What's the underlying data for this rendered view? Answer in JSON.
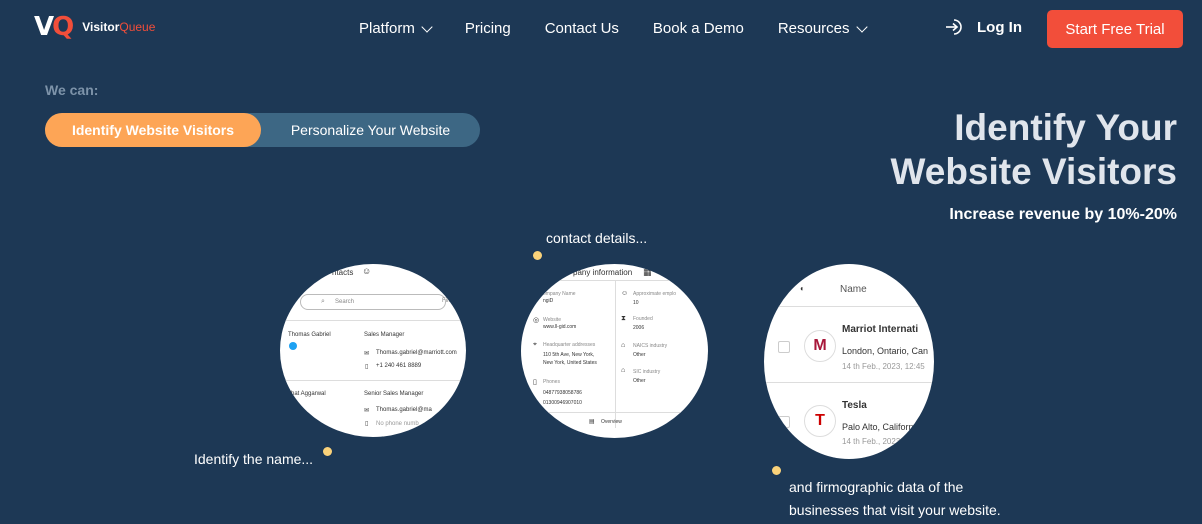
{
  "brand": {
    "mark_v": "V",
    "mark_q": "Q",
    "name_main": "Visitor",
    "name_q": "Queue",
    "accent": "#f24e3a"
  },
  "nav": {
    "items": [
      {
        "label": "Platform",
        "dropdown": true
      },
      {
        "label": "Pricing",
        "dropdown": false
      },
      {
        "label": "Contact Us",
        "dropdown": false
      },
      {
        "label": "Book a Demo",
        "dropdown": false
      },
      {
        "label": "Resources",
        "dropdown": true
      }
    ],
    "login": "Log In",
    "cta": "Start Free Trial"
  },
  "hero": {
    "we_can": "We can:",
    "toggle": {
      "active": "Identify Website Visitors",
      "inactive": "Personalize Your Website"
    },
    "headline_line1": "Identify Your",
    "headline_line2": "Website Visitors",
    "subhead": "Increase revenue by 10%-20%"
  },
  "captions": {
    "name": "Identify the name...",
    "contact": "contact details...",
    "firmo_line1": "and firmographic data of the",
    "firmo_line2": "businesses that visit your website."
  },
  "circle1": {
    "tab": "ntacts",
    "search": "Search",
    "filter": "Filt",
    "p1_name": "Thomas Gabriel",
    "p1_title": "Sales Manager",
    "p1_email": "Thomas.gabriel@marriott.com",
    "p1_phone": "+1 240 461 8889",
    "p2_name": "shat Aggarwal",
    "p2_title": "Senior Sales Manager",
    "p2_email": "Thomas.gabriel@ma",
    "p2_phone": "No phone numb"
  },
  "circle2": {
    "tab": "pany information",
    "company_name_label": "ompany Name",
    "company_name": "ngiD",
    "website_label": "Website",
    "website": "www.ll-gid.com",
    "hq_label": "Headquarter addresses",
    "hq_line1": "110 5th Ave, New York,",
    "hq_line2": "New York, United States",
    "phones_label": "Phones",
    "phone1": "04877938058786",
    "phone2": "01300946907010",
    "employees_label": "Approximate emplo",
    "employees": "10",
    "founded_label": "Founded",
    "founded": "2006",
    "naics_label": "NAICS industry",
    "naics": "Other",
    "sic_label": "SIC industry",
    "sic": "Other",
    "overview": "Overview"
  },
  "circle3": {
    "col_name": "Name",
    "c1_name": "Marriot Internati",
    "c1_loc": "London, Ontario, Can",
    "c1_date": "14 th Feb., 2023, 12:45",
    "c2_name": "Tesla",
    "c2_loc": "Palo Alto, Californ",
    "c2_date": "14 th Feb., 2023",
    "c1_logo": "M",
    "c2_logo": "T"
  }
}
